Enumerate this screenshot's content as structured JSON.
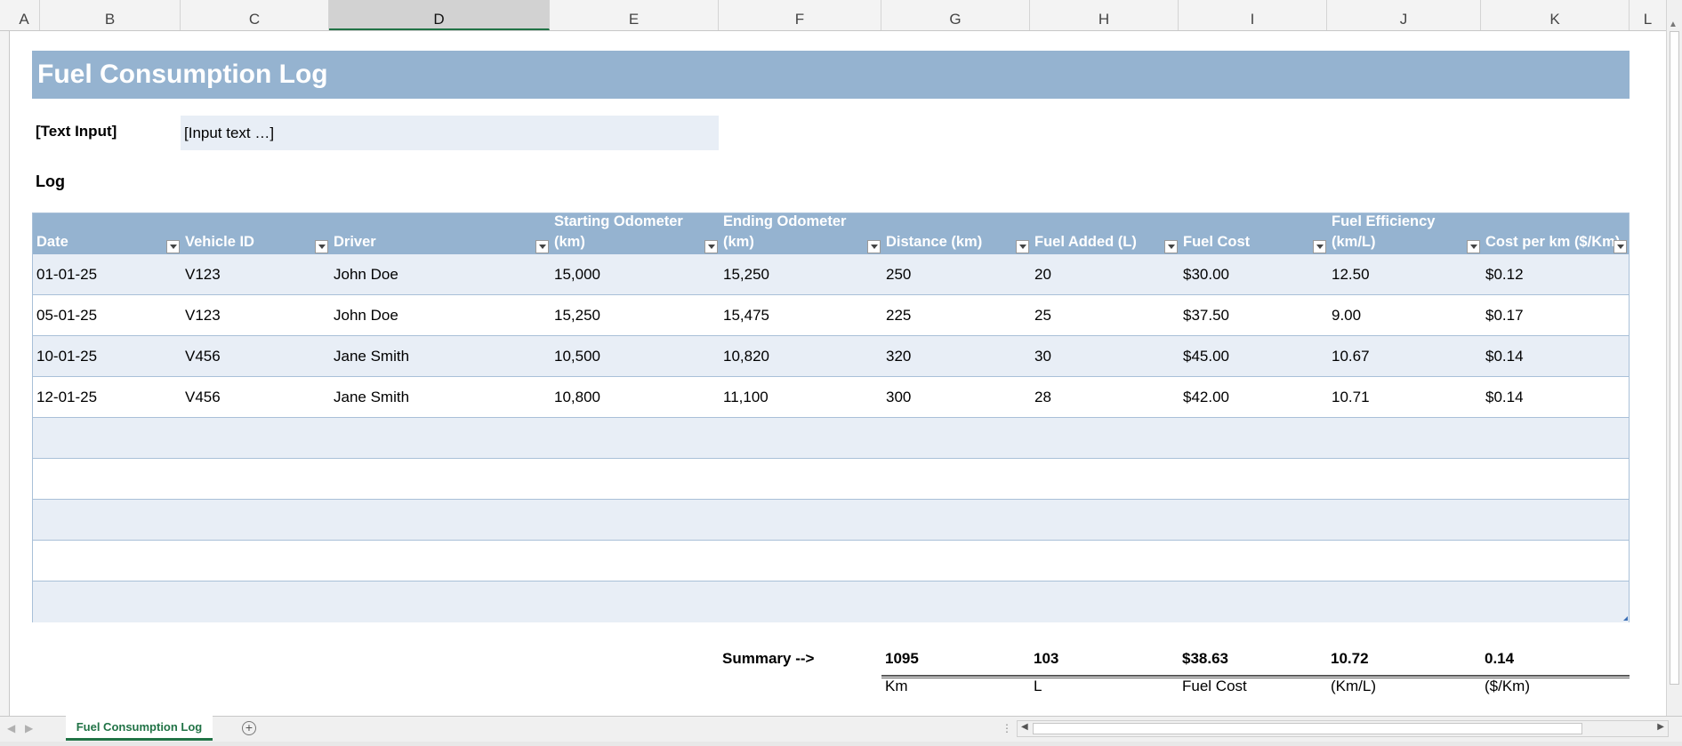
{
  "sheet": {
    "columns": [
      "A",
      "B",
      "C",
      "D",
      "E",
      "F",
      "G",
      "H",
      "I",
      "J",
      "K",
      "L"
    ],
    "selected_column": "D"
  },
  "title": "Fuel Consumption Log",
  "text_input": {
    "label": "[Text Input]",
    "value": "[Input text …]"
  },
  "log_label": "Log",
  "table": {
    "headers": [
      "Date",
      "Vehicle ID",
      "Driver",
      "Starting Odometer\n(km)",
      "Ending Odometer\n(km)",
      "Distance (km)",
      "Fuel Added (L)",
      "Fuel Cost",
      "Fuel Efficiency\n(km/L)",
      "Cost per km ($/Km)"
    ],
    "rows": [
      [
        "01-01-25",
        "V123",
        "John Doe",
        "15,000",
        "15,250",
        "250",
        "20",
        "$30.00",
        "12.50",
        "$0.12"
      ],
      [
        "05-01-25",
        "V123",
        "John Doe",
        "15,250",
        "15,475",
        "225",
        "25",
        "$37.50",
        "9.00",
        "$0.17"
      ],
      [
        "10-01-25",
        "V456",
        "Jane Smith",
        "10,500",
        "10,820",
        "320",
        "30",
        "$45.00",
        "10.67",
        "$0.14"
      ],
      [
        "12-01-25",
        "V456",
        "Jane Smith",
        "10,800",
        "11,100",
        "300",
        "28",
        "$42.00",
        "10.71",
        "$0.14"
      ],
      [
        "",
        "",
        "",
        "",
        "",
        "",
        "",
        "",
        "",
        ""
      ],
      [
        "",
        "",
        "",
        "",
        "",
        "",
        "",
        "",
        "",
        ""
      ],
      [
        "",
        "",
        "",
        "",
        "",
        "",
        "",
        "",
        "",
        ""
      ],
      [
        "",
        "",
        "",
        "",
        "",
        "",
        "",
        "",
        "",
        ""
      ],
      [
        "",
        "",
        "",
        "",
        "",
        "",
        "",
        "",
        "",
        ""
      ]
    ]
  },
  "summary": {
    "label": "Summary -->",
    "values": [
      "1095",
      "103",
      "$38.63",
      "10.72",
      "0.14"
    ],
    "units": [
      "Km",
      "L",
      "Fuel Cost",
      "(Km/L)",
      "($/Km)"
    ]
  },
  "tabs": {
    "sheet_tab": "Fuel Consumption Log",
    "add_sheet": "+"
  },
  "colors": {
    "header_fill": "#95b3d0",
    "band_fill": "#e8eef6",
    "tab_accent": "#217346"
  },
  "icons": [
    "filter-dropdown-icon",
    "add-sheet-icon",
    "scroll-left-icon",
    "scroll-right-icon",
    "resize-handle-icon"
  ]
}
